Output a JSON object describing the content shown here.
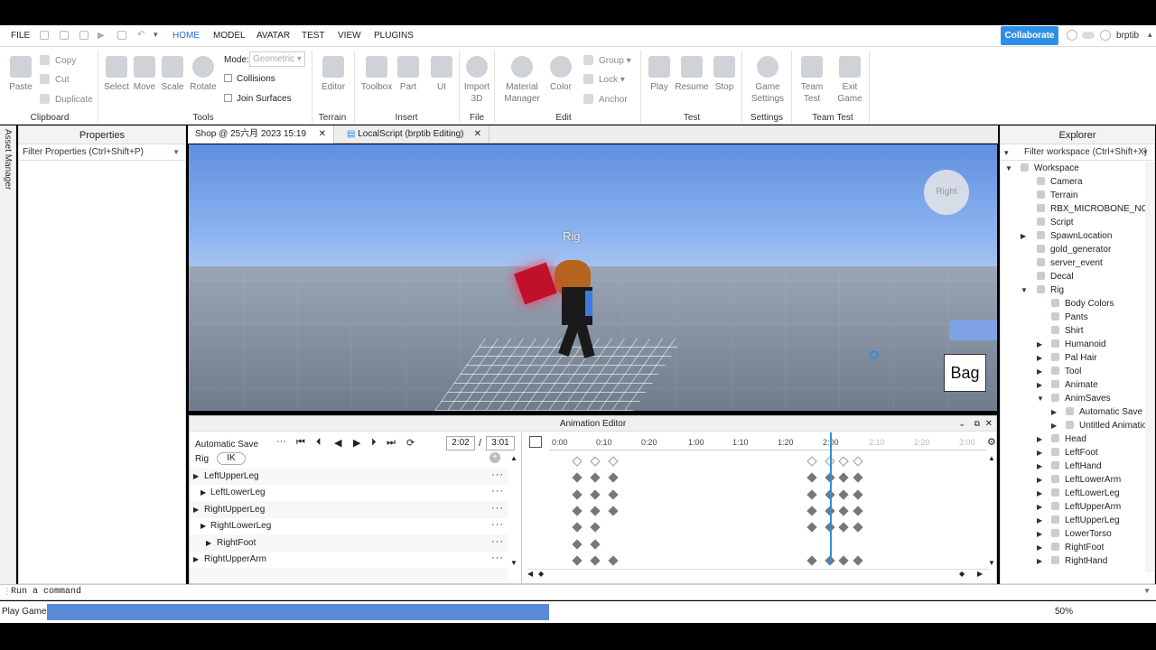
{
  "menubar": {
    "file": "FILE",
    "tabs": [
      "HOME",
      "MODEL",
      "AVATAR",
      "TEST",
      "VIEW",
      "PLUGINS"
    ],
    "collaborate": "Collaborate",
    "user": "brptib"
  },
  "ribbon": {
    "paste": "Paste",
    "copy": "Copy",
    "cut": "Cut",
    "duplicate": "Duplicate",
    "clipboard": "Clipboard",
    "select": "Select",
    "move": "Move",
    "scale": "Scale",
    "rotate": "Rotate",
    "mode_label": "Mode:",
    "mode_value": "Geometric",
    "collisions": "Collisions",
    "join_surfaces": "Join Surfaces",
    "tools": "Tools",
    "editor": "Editor",
    "terrain": "Terrain",
    "toolbox": "Toolbox",
    "part": "Part",
    "ui": "UI",
    "insert": "Insert",
    "import3d_1": "Import",
    "import3d_2": "3D",
    "file": "File",
    "material_1": "Material",
    "material_2": "Manager",
    "color": "Color",
    "group": "Group",
    "lock": "Lock",
    "anchor": "Anchor",
    "edit": "Edit",
    "play": "Play",
    "resume": "Resume",
    "stop": "Stop",
    "test": "Test",
    "game_settings_1": "Game",
    "game_settings_2": "Settings",
    "settings": "Settings",
    "team_test_1": "Team",
    "team_test_2": "Test",
    "exit_game_1": "Exit",
    "exit_game_2": "Game",
    "team_test_group": "Team Test"
  },
  "left": {
    "asset_manager": "Asset Manager"
  },
  "properties": {
    "title": "Properties",
    "filter": "Filter Properties (Ctrl+Shift+P)"
  },
  "tabs": {
    "tab1": "Shop @ 25六月 2023 15:19",
    "tab2": "LocalScript (brptib Editing)"
  },
  "viewport": {
    "rig_label": "Rig",
    "gizmo_label": "Right",
    "bag": "Bag"
  },
  "animation_editor": {
    "title": "Animation Editor",
    "animation_name": "Automatic Save",
    "current_time": "2:02",
    "separator": "/",
    "end_time": "3:01",
    "rig": "Rig",
    "ik": "IK",
    "tracks": [
      {
        "name": "LeftUpperLeg"
      },
      {
        "name": "LeftLowerLeg"
      },
      {
        "name": "RightUpperLeg"
      },
      {
        "name": "RightLowerLeg"
      },
      {
        "name": "RightFoot"
      },
      {
        "name": "RightUpperArm"
      }
    ],
    "ticks": [
      "0:00",
      "0:10",
      "0:20",
      "1:00",
      "1:10",
      "1:20",
      "2:00",
      "2:10",
      "2:20",
      "3:00"
    ],
    "playhead_time": "2:02"
  },
  "explorer": {
    "title": "Explorer",
    "filter": "Filter workspace (Ctrl+Shift+X)",
    "items": [
      "Workspace",
      "Camera",
      "Terrain",
      "RBX_MICROBONE_NODE",
      "Script",
      "SpawnLocation",
      "gold_generator",
      "server_event",
      "Decal",
      "Rig",
      "Body Colors",
      "Pants",
      "Shirt",
      "Humanoid",
      "Pal Hair",
      "Tool",
      "Animate",
      "AnimSaves",
      "Automatic Save",
      "Untitled Animation",
      "Head",
      "LeftFoot",
      "LeftHand",
      "LeftLowerArm",
      "LeftLowerLeg",
      "LeftUpperArm",
      "LeftUpperLeg",
      "LowerTorso",
      "RightFoot",
      "RightHand"
    ]
  },
  "command": {
    "placeholder": "Run a command"
  },
  "status": {
    "label": "Play Game",
    "progress_percent": 50,
    "percent_text": "50%"
  },
  "colors": {
    "accent": "#2f8fe6",
    "progress": "#5b8bd6"
  }
}
